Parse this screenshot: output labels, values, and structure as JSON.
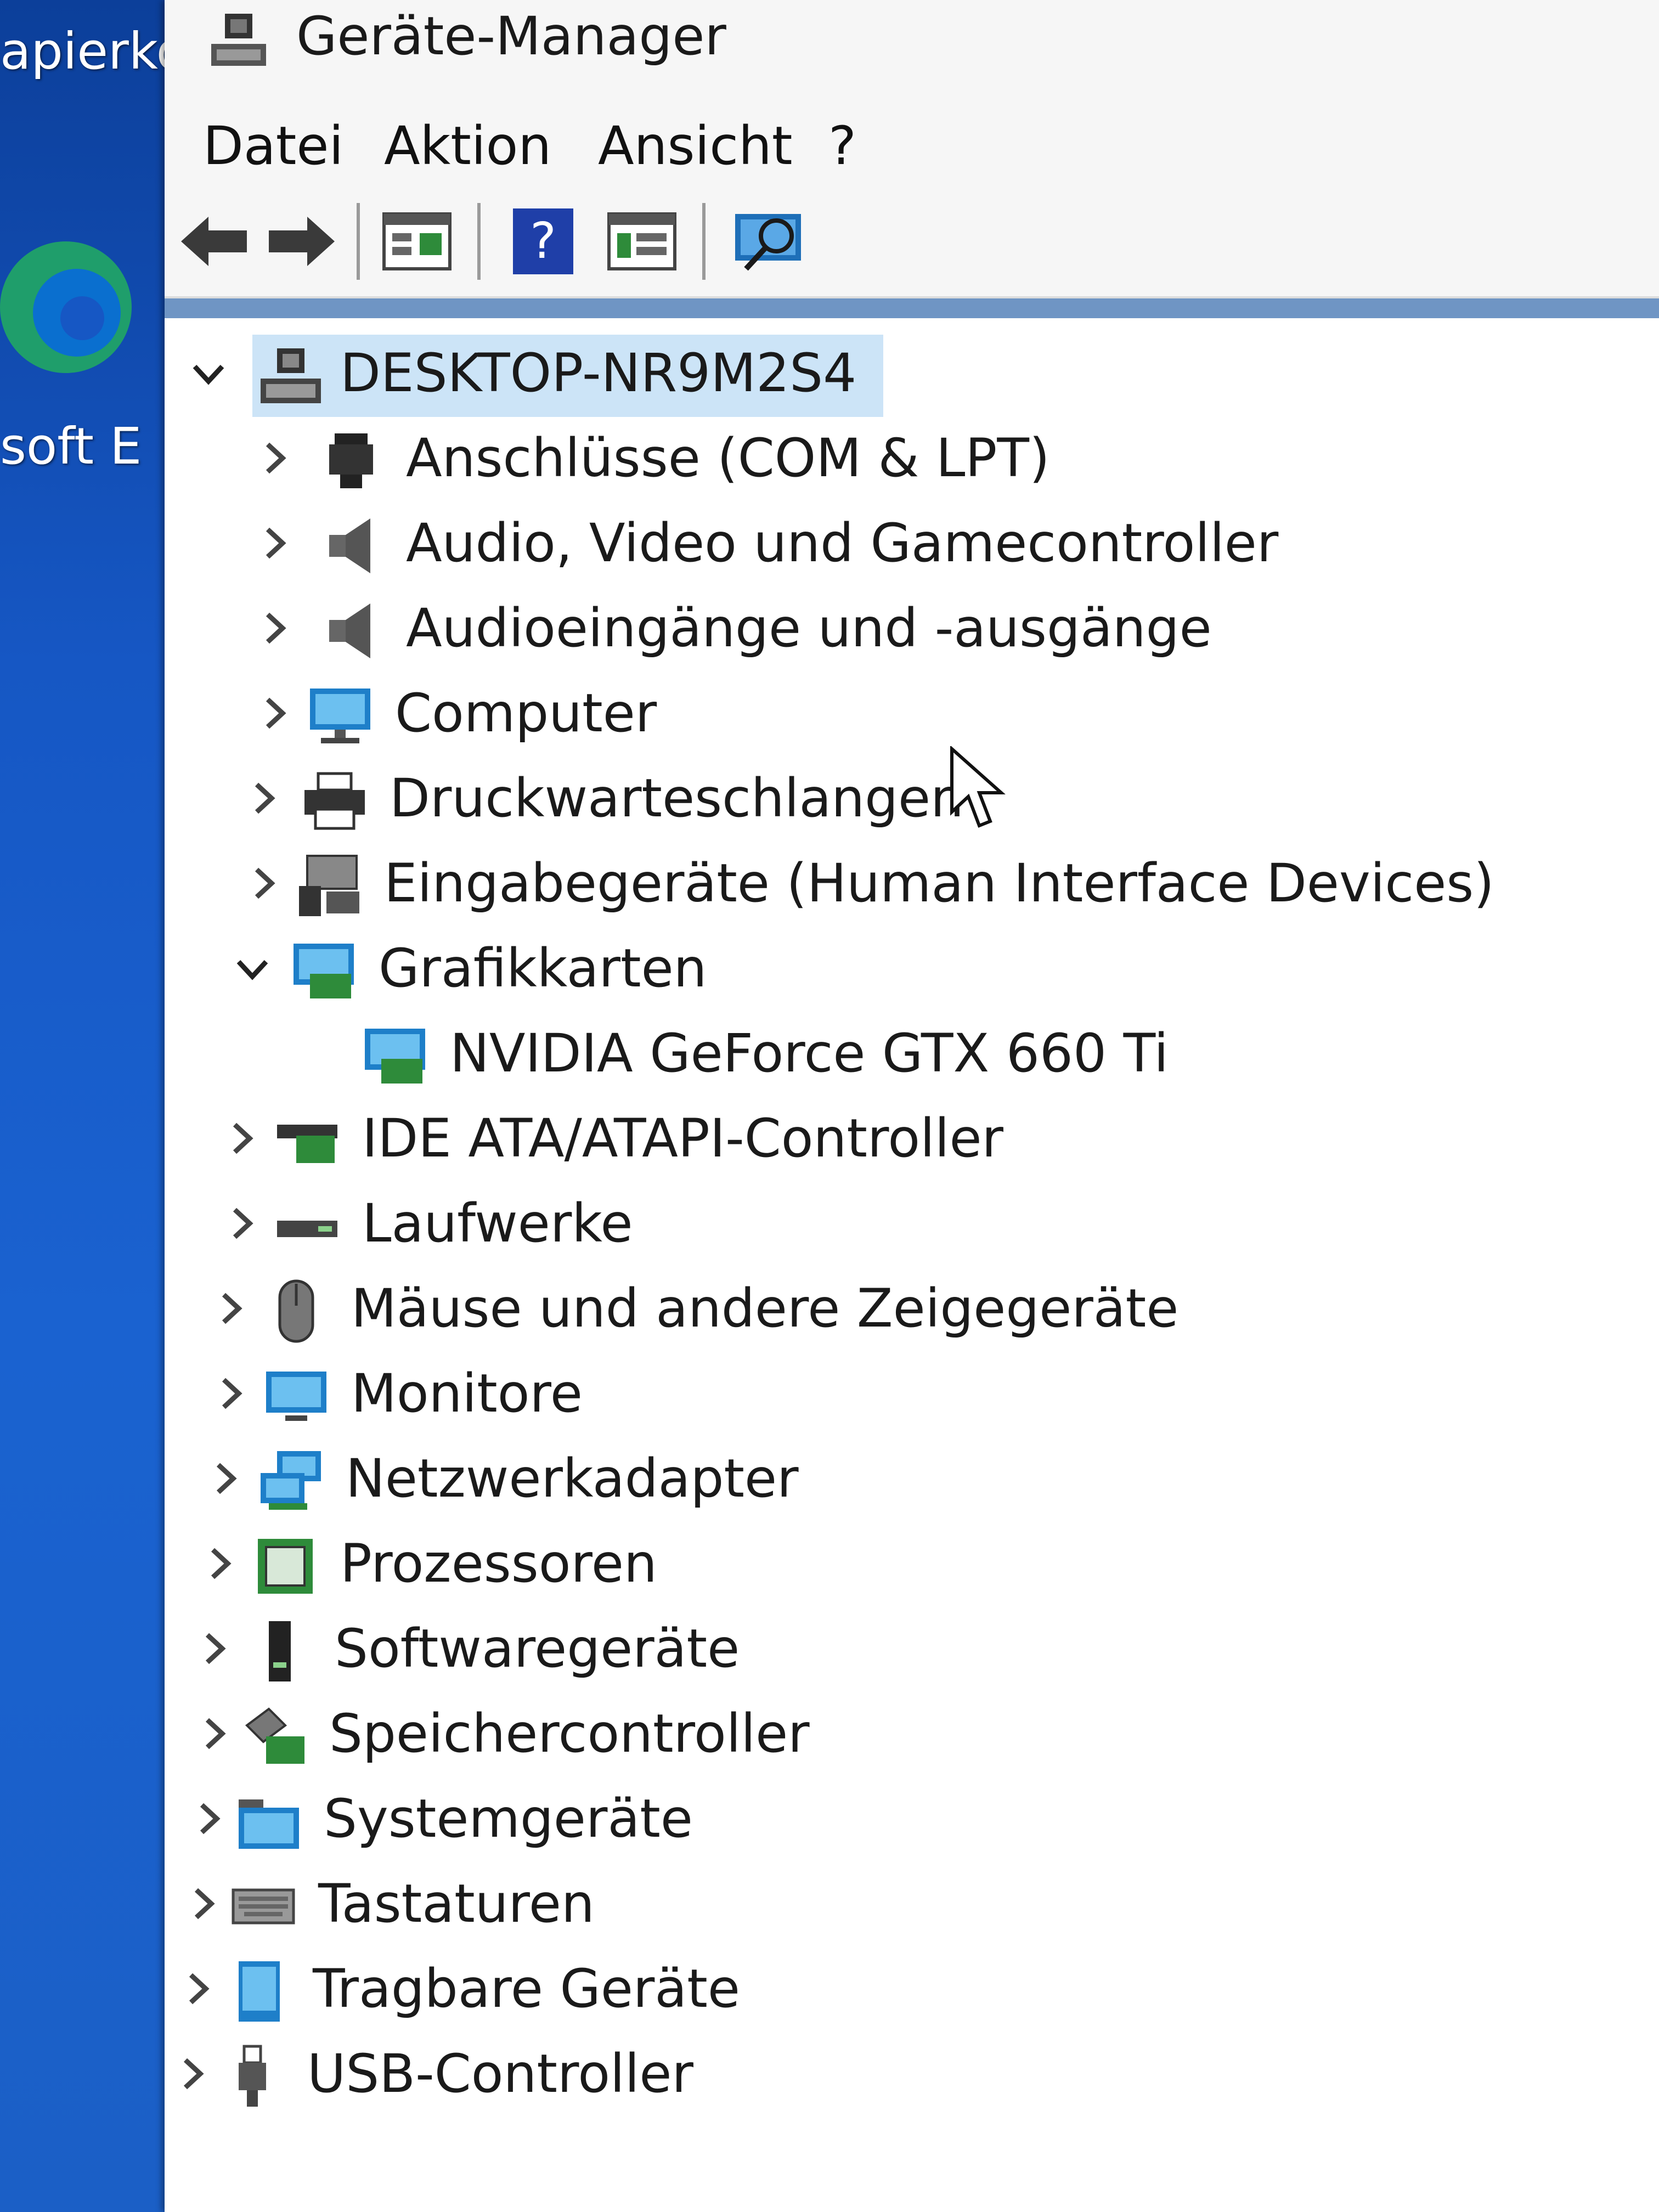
{
  "desktop": {
    "label_top": "apierko",
    "label_mid": "soft E"
  },
  "window": {
    "title": "Geräte-Manager",
    "menu": {
      "file": "Datei",
      "action": "Aktion",
      "view": "Ansicht",
      "help": "?"
    },
    "toolbar": {
      "items": [
        "back-icon",
        "forward-icon",
        "properties-icon",
        "help-icon",
        "view-icon",
        "scan-icon"
      ]
    }
  },
  "tree": {
    "root": "DESKTOP-NR9M2S4",
    "categories": [
      {
        "label": "Anschlüsse (COM & LPT)",
        "icon": "port-icon",
        "expanded": false
      },
      {
        "label": "Audio, Video und Gamecontroller",
        "icon": "speaker-icon",
        "expanded": false
      },
      {
        "label": "Audioeingänge und -ausgänge",
        "icon": "speaker-icon",
        "expanded": false
      },
      {
        "label": "Computer",
        "icon": "monitor-icon",
        "expanded": false
      },
      {
        "label": "Druckwarteschlangen",
        "icon": "printer-icon",
        "expanded": false
      },
      {
        "label": "Eingabegeräte (Human Interface Devices)",
        "icon": "hid-icon",
        "expanded": false
      },
      {
        "label": "Grafikkarten",
        "icon": "display-adapter-icon",
        "expanded": true
      },
      {
        "label": "NVIDIA GeForce GTX 660 Ti",
        "icon": "display-adapter-icon",
        "child": true
      },
      {
        "label": "IDE ATA/ATAPI-Controller",
        "icon": "ide-icon",
        "expanded": false
      },
      {
        "label": "Laufwerke",
        "icon": "drive-icon",
        "expanded": false
      },
      {
        "label": "Mäuse und andere Zeigegeräte",
        "icon": "mouse-icon",
        "expanded": false
      },
      {
        "label": "Monitore",
        "icon": "monitor-icon",
        "expanded": false
      },
      {
        "label": "Netzwerkadapter",
        "icon": "network-icon",
        "expanded": false
      },
      {
        "label": "Prozessoren",
        "icon": "processor-icon",
        "expanded": false
      },
      {
        "label": "Softwaregeräte",
        "icon": "software-device-icon",
        "expanded": false
      },
      {
        "label": "Speichercontroller",
        "icon": "storage-controller-icon",
        "expanded": false
      },
      {
        "label": "Systemgeräte",
        "icon": "folder-icon",
        "expanded": false
      },
      {
        "label": "Tastaturen",
        "icon": "keyboard-icon",
        "expanded": false
      },
      {
        "label": "Tragbare Geräte",
        "icon": "portable-device-icon",
        "expanded": false
      },
      {
        "label": "USB-Controller",
        "icon": "usb-icon",
        "expanded": false
      }
    ]
  },
  "colors": {
    "selection": "#cce4f7",
    "desktop_blue": "#1a5bb8",
    "window_bg": "#ffffff",
    "text": "#1a1a1a"
  }
}
